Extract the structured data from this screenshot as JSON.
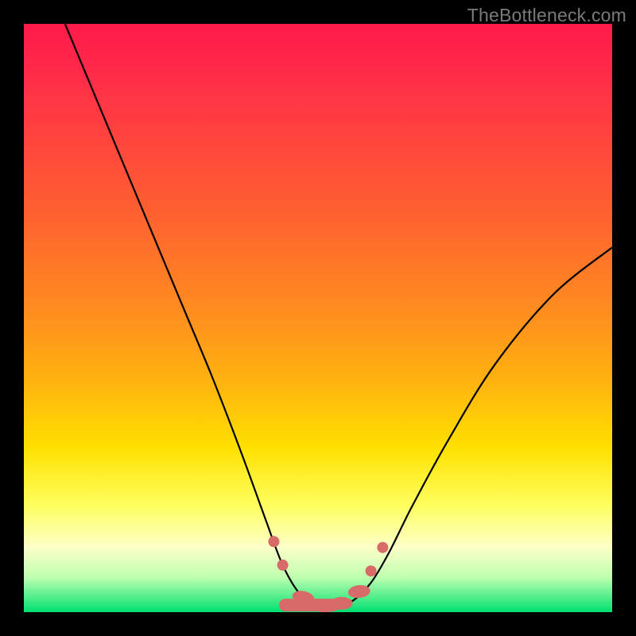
{
  "watermark": "TheBottleneck.com",
  "chart_data": {
    "type": "line",
    "title": "",
    "xlabel": "",
    "ylabel": "",
    "xlim": [
      0,
      100
    ],
    "ylim": [
      0,
      100
    ],
    "grid": false,
    "legend": false,
    "series": [
      {
        "name": "bottleneck-curve",
        "color": "#000000",
        "x": [
          7,
          12,
          17,
          22,
          27,
          32,
          37,
          41,
          44,
          47,
          50,
          53,
          56,
          59,
          62,
          66,
          72,
          80,
          90,
          100
        ],
        "y": [
          100,
          88,
          76,
          64,
          52,
          40,
          27,
          16,
          8,
          3,
          1,
          1,
          2,
          5,
          10,
          18,
          29,
          42,
          54,
          62
        ]
      },
      {
        "name": "sweet-spot-markers",
        "color": "#d86a6a",
        "type": "scatter",
        "x": [
          42.5,
          44.0,
          47.5,
          51.0,
          54.0,
          57.0,
          59.0,
          61.0
        ],
        "y": [
          12.0,
          8.0,
          2.5,
          1.0,
          1.5,
          3.5,
          7.0,
          11.0
        ]
      }
    ]
  }
}
